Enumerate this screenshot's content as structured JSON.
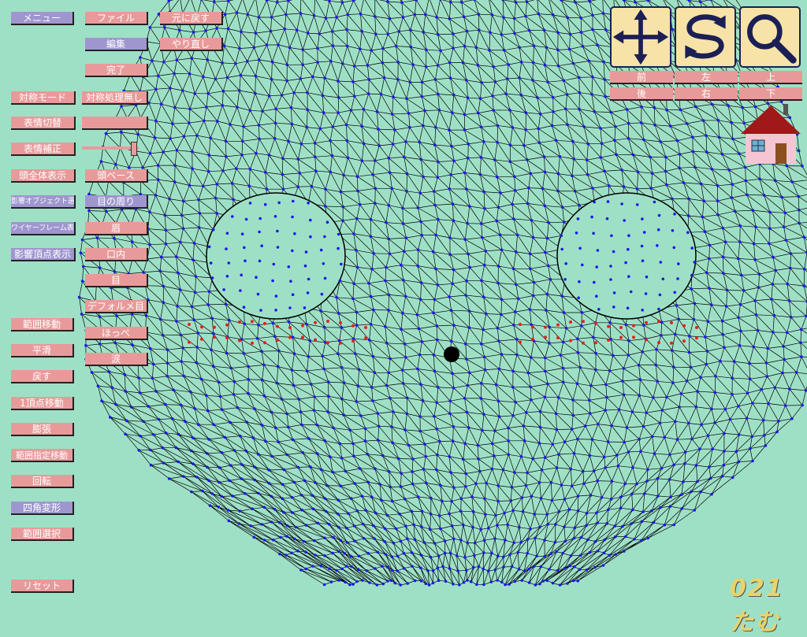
{
  "left_menu": {
    "col1": [
      {
        "id": "menu",
        "label": "メニュー",
        "style": "purple"
      },
      {
        "id": "symmetry-mode",
        "label": "対称モード",
        "style": "pink"
      },
      {
        "id": "expression-switch",
        "label": "表情切替",
        "style": "pink"
      },
      {
        "id": "expression-correct",
        "label": "表情補正",
        "style": "pink"
      },
      {
        "id": "show-whole-head",
        "label": "頭全体表示",
        "style": "pink"
      },
      {
        "id": "influence-object-select",
        "label": "影響オブジェクト選択",
        "style": "purple"
      },
      {
        "id": "wireframe-display",
        "label": "ワイヤーフレーム表示",
        "style": "purple"
      },
      {
        "id": "influence-vertex-display",
        "label": "影響頂点表示",
        "style": "purple"
      },
      {
        "id": "range-move",
        "label": "範囲移動",
        "style": "pink"
      },
      {
        "id": "smooth",
        "label": "平滑",
        "style": "pink"
      },
      {
        "id": "revert",
        "label": "戻す",
        "style": "pink"
      },
      {
        "id": "single-vertex-move",
        "label": "1頂点移動",
        "style": "pink"
      },
      {
        "id": "expand",
        "label": "膨張",
        "style": "pink"
      },
      {
        "id": "range-specified-move",
        "label": "範囲指定移動",
        "style": "pink"
      },
      {
        "id": "rotate",
        "label": "回転",
        "style": "pink"
      },
      {
        "id": "quad-transform",
        "label": "四角変形",
        "style": "purple"
      },
      {
        "id": "range-select",
        "label": "範囲選択",
        "style": "pink"
      },
      {
        "id": "reset",
        "label": "リセット",
        "style": "pink"
      }
    ],
    "col2": [
      {
        "id": "file",
        "label": "ファイル",
        "style": "pink"
      },
      {
        "id": "edit",
        "label": "編集",
        "style": "purple"
      },
      {
        "id": "done",
        "label": "完了",
        "style": "pink"
      },
      {
        "id": "no-symmetry",
        "label": "対称処理無し",
        "style": "pink"
      },
      {
        "id": "expression-value",
        "label": "",
        "style": "pink"
      },
      {
        "id": "head-base",
        "label": "頭ベース",
        "style": "pink"
      },
      {
        "id": "around-eyes",
        "label": "目の周り",
        "style": "purple"
      },
      {
        "id": "eyebrows",
        "label": "眉",
        "style": "pink"
      },
      {
        "id": "mouth-inside",
        "label": "口内",
        "style": "pink"
      },
      {
        "id": "eyes",
        "label": "目",
        "style": "pink"
      },
      {
        "id": "deformed-eyes",
        "label": "デフォルメ目",
        "style": "pink"
      },
      {
        "id": "cheeks",
        "label": "ほっぺ",
        "style": "pink"
      },
      {
        "id": "tears",
        "label": "涙",
        "style": "pink"
      }
    ],
    "col3": [
      {
        "id": "undo",
        "label": "元に戻す",
        "style": "pink"
      },
      {
        "id": "redo",
        "label": "やり直し",
        "style": "pink"
      }
    ]
  },
  "view_tools": [
    {
      "id": "move",
      "icon": "move-arrows-icon"
    },
    {
      "id": "rotate",
      "icon": "rotate-arrows-icon"
    },
    {
      "id": "zoom",
      "icon": "magnifier-icon"
    }
  ],
  "direction_buttons": {
    "front": "前",
    "left": "左",
    "up": "上",
    "back": "後",
    "right": "右",
    "down": "下"
  },
  "logo_text": "021 たむ",
  "colors": {
    "background": "#9ee0c6",
    "button_pink": "#e89a9a",
    "button_purple": "#a096cf",
    "tool_bg": "#f7e3a8",
    "mesh_vertex": "#1a1ae6",
    "selected_vertex": "#e62020"
  }
}
